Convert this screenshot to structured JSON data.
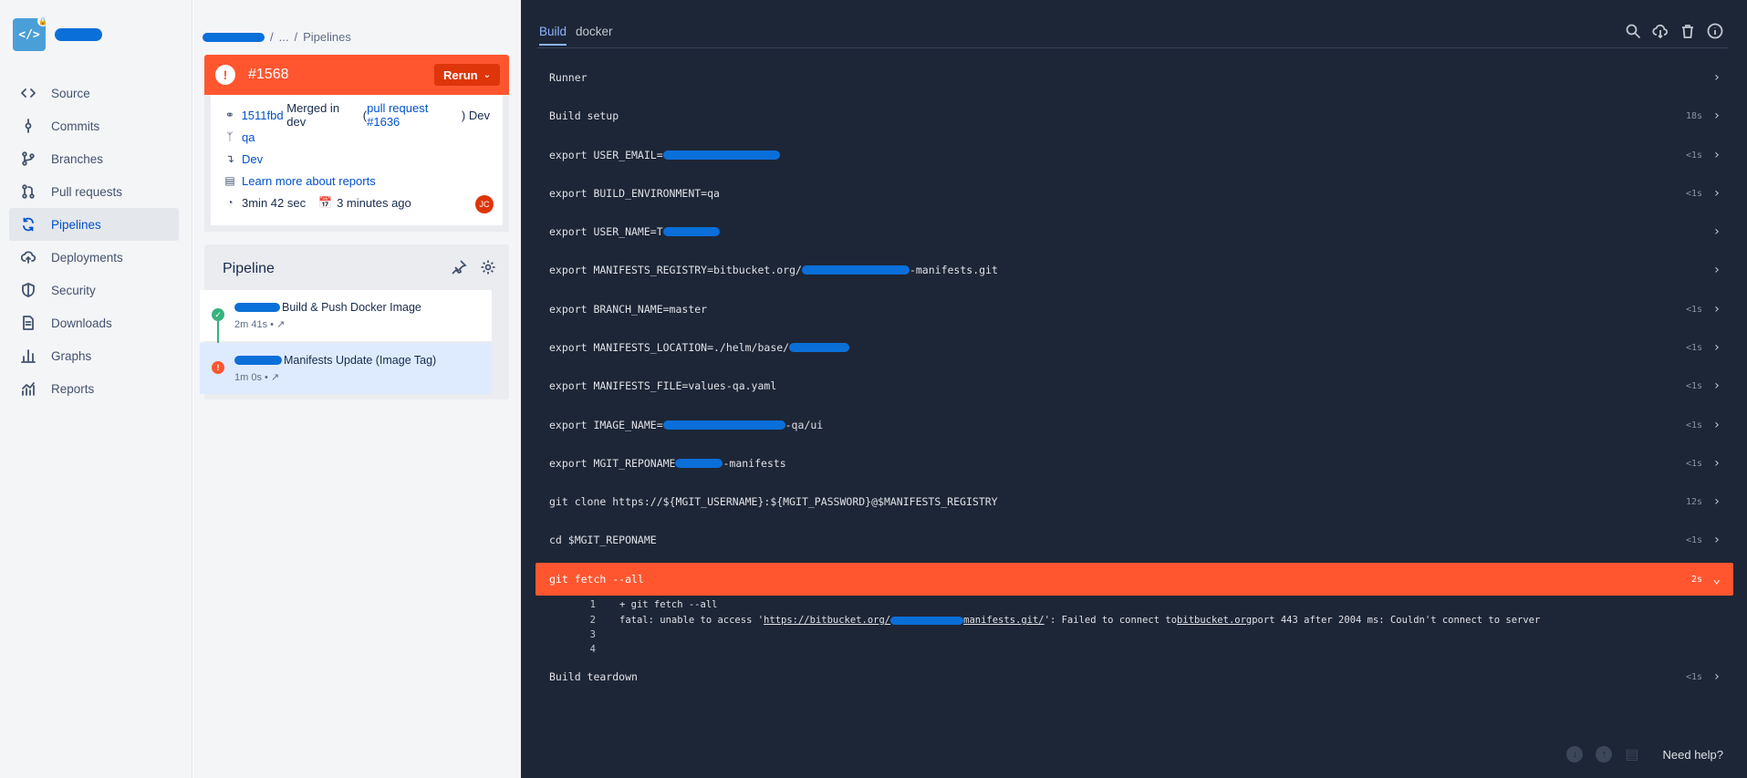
{
  "repo": {
    "avatar_text": "</>"
  },
  "nav": [
    {
      "label": "Source",
      "icon": "code-icon"
    },
    {
      "label": "Commits",
      "icon": "commit-icon"
    },
    {
      "label": "Branches",
      "icon": "branch-icon"
    },
    {
      "label": "Pull requests",
      "icon": "pull-request-icon"
    },
    {
      "label": "Pipelines",
      "icon": "pipelines-icon",
      "active": true
    },
    {
      "label": "Deployments",
      "icon": "cloud-upload-icon"
    },
    {
      "label": "Security",
      "icon": "shield-icon"
    },
    {
      "label": "Downloads",
      "icon": "document-icon"
    },
    {
      "label": "Graphs",
      "icon": "bar-chart-icon"
    },
    {
      "label": "Reports",
      "icon": "report-icon"
    }
  ],
  "breadcrumb": {
    "ellipsis": "...",
    "current": "Pipelines"
  },
  "build": {
    "number": "#1568",
    "rerun_label": "Rerun",
    "commit_hash": "1511fbd",
    "commit_text": "Merged in dev",
    "pr_open": "(",
    "pr_link": "pull request #1636",
    "pr_close": ")",
    "pr_source": "Dev",
    "target_branch": "qa",
    "source_branch": "Dev",
    "reports_link": "Learn more about reports",
    "duration": "3min 42 sec",
    "time_ago": "3 minutes ago",
    "avatar_initials": "JC",
    "status_color": "#ff5630"
  },
  "pipeline": {
    "title": "Pipeline",
    "steps": [
      {
        "name": "Build & Push Docker Image",
        "meta": "2m 41s  •  ↗",
        "status": "success"
      },
      {
        "name": "Manifests Update (Image Tag)",
        "meta": "1m 0s  •  ↗",
        "status": "failed"
      }
    ]
  },
  "log": {
    "tabs": [
      "Build",
      "docker"
    ],
    "commands": [
      {
        "text": "Runner",
        "duration": ""
      },
      {
        "text": "Build setup",
        "duration": "18s"
      },
      {
        "text": "export USER_EMAIL=",
        "duration": "<1s"
      },
      {
        "text": "export BUILD_ENVIRONMENT=qa",
        "duration": "<1s"
      },
      {
        "text": "export USER_NAME=T",
        "duration": ""
      },
      {
        "text": "export MANIFESTS_REGISTRY=bitbucket.org/",
        "suffix": "-manifests.git",
        "duration": ""
      },
      {
        "text": "export BRANCH_NAME=master",
        "duration": "<1s"
      },
      {
        "text": "export MANIFESTS_LOCATION=./helm/base/",
        "duration": "<1s"
      },
      {
        "text": "export MANIFESTS_FILE=values-qa.yaml",
        "duration": "<1s"
      },
      {
        "text": "export IMAGE_NAME=",
        "suffix": "-qa/ui",
        "duration": "<1s"
      },
      {
        "text": "export MGIT_REPONAME",
        "suffix": "-manifests",
        "duration": "<1s"
      },
      {
        "text": "git clone https://${MGIT_USERNAME}:${MGIT_PASSWORD}@$MANIFESTS_REGISTRY",
        "duration": "12s"
      },
      {
        "text": "cd $MGIT_REPONAME",
        "duration": "<1s"
      },
      {
        "text": "git fetch --all",
        "duration": "2s",
        "failed": true
      }
    ],
    "output_lines": [
      {
        "num": "1",
        "text": "+ git fetch --all"
      },
      {
        "num": "2",
        "pre": "fatal: unable to access '",
        "url_a": "https://bitbucket.org/",
        "url_b": "manifests.git/",
        "mid": "': Failed to connect to ",
        "host": "bitbucket.org",
        "post": " port 443 after 2004 ms: Couldn't connect to server"
      },
      {
        "num": "3",
        "text": ""
      },
      {
        "num": "4",
        "text": ""
      }
    ],
    "teardown": {
      "text": "Build teardown",
      "duration": "<1s"
    },
    "need_help": "Need help?"
  }
}
